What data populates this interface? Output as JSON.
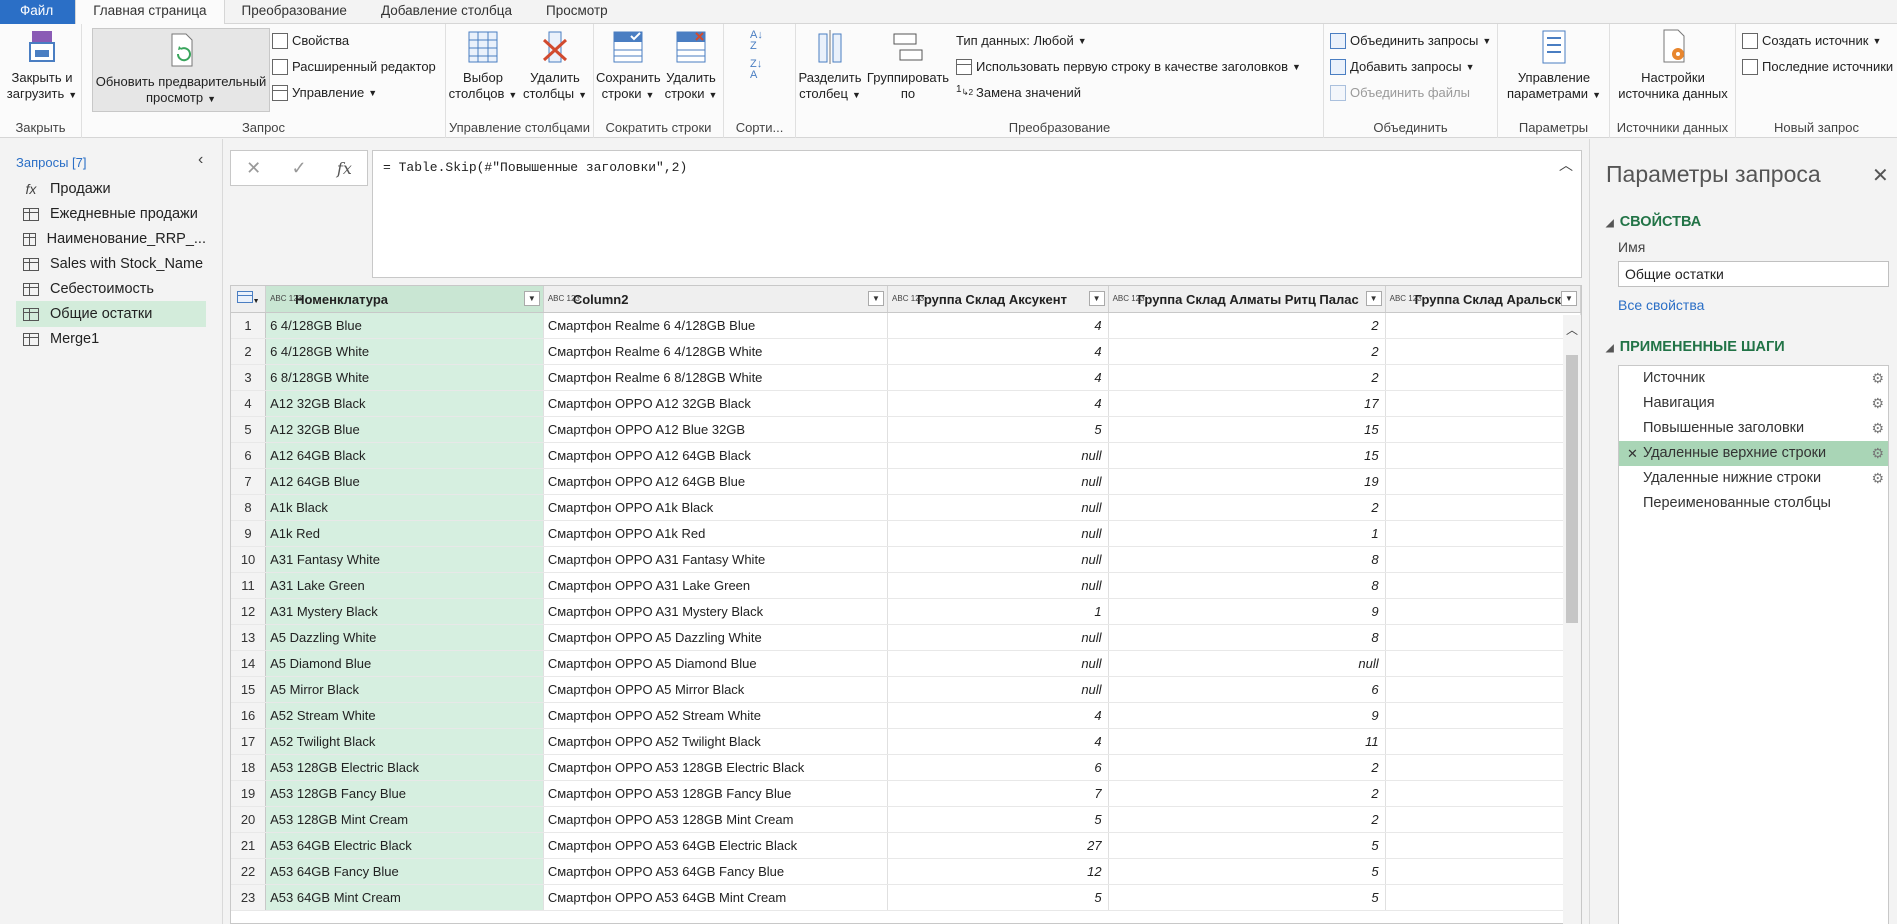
{
  "tabs": [
    {
      "label": "Файл"
    },
    {
      "label": "Главная страница"
    },
    {
      "label": "Преобразование"
    },
    {
      "label": "Добавление столбца"
    },
    {
      "label": "Просмотр"
    }
  ],
  "ribbon": {
    "close_load": "Закрыть и загрузить",
    "refresh": "Обновить предварительный просмотр",
    "properties": "Свойства",
    "advanced_editor": "Расширенный редактор",
    "manage": "Управление",
    "choose_columns": "Выбор столбцов",
    "remove_columns": "Удалить столбцы",
    "keep_rows": "Сохранить строки",
    "remove_rows": "Удалить строки",
    "split_column": "Разделить столбец",
    "group_by": "Группировать по",
    "data_type": "Тип данных: Любой",
    "first_row_headers": "Использовать первую строку в качестве заголовков",
    "replace_values": "Замена значений",
    "merge_queries": "Объединить запросы",
    "append_queries": "Добавить запросы",
    "combine_files": "Объединить файлы",
    "manage_params": "Управление параметрами",
    "datasource_settings": "Настройки источника данных",
    "new_source": "Создать источник",
    "recent_sources": "Последние источники",
    "groups": {
      "close": "Закрыть",
      "query": "Запрос",
      "manage_columns": "Управление столбцами",
      "reduce_rows": "Сократить строки",
      "sort": "Сорти...",
      "transform": "Преобразование",
      "combine": "Объединить",
      "parameters": "Параметры",
      "data_sources": "Источники данных",
      "new_query": "Новый запрос"
    }
  },
  "queries": {
    "header": "Запросы [7]",
    "items": [
      {
        "label": "Продажи",
        "icon": "fx-icon"
      },
      {
        "label": "Ежедневные продажи",
        "icon": "table-icon"
      },
      {
        "label": "Наименование_RRP_...",
        "icon": "table-icon"
      },
      {
        "label": "Sales with Stock_Name",
        "icon": "table-icon"
      },
      {
        "label": "Себестоимость",
        "icon": "table-icon"
      },
      {
        "label": "Общие остатки",
        "icon": "table-icon"
      },
      {
        "label": "Merge1",
        "icon": "table-icon"
      }
    ]
  },
  "formula": "= Table.Skip(#\"Повышенные заголовки\",2)",
  "grid": {
    "columns": [
      {
        "type": "ABC 123",
        "name": "Номенклатура"
      },
      {
        "type": "ABC 123",
        "name": "Column2"
      },
      {
        "type": "ABC 123",
        "name": "Группа Склад Аксукент"
      },
      {
        "type": "ABC 123",
        "name": "Группа Склад Алматы Ритц Палас"
      },
      {
        "type": "ABC 123",
        "name": "Группа Склад Аральск"
      }
    ],
    "rows": [
      [
        "1",
        "6 4/128GB Blue",
        "Смартфон Realme 6 4/128GB Blue",
        "4",
        "2",
        ""
      ],
      [
        "2",
        "6 4/128GB White",
        "Смартфон Realme 6 4/128GB White",
        "4",
        "2",
        ""
      ],
      [
        "3",
        "6 8/128GB White",
        "Смартфон Realme 6 8/128GB White",
        "4",
        "2",
        ""
      ],
      [
        "4",
        "A12 32GB Black",
        "Смартфон OPPO A12 32GB Black",
        "4",
        "17",
        "n"
      ],
      [
        "5",
        "A12 32GB Blue",
        "Смартфон OPPO A12 Blue 32GB",
        "5",
        "15",
        ""
      ],
      [
        "6",
        "A12 64GB Black",
        "Смартфон OPPO A12 64GB Black",
        "null",
        "15",
        "n"
      ],
      [
        "7",
        "A12 64GB Blue",
        "Смартфон OPPO A12 64GB Blue",
        "null",
        "19",
        "n"
      ],
      [
        "8",
        "A1k Black",
        "Смартфон OPPO A1k Black",
        "null",
        "2",
        "n"
      ],
      [
        "9",
        "A1k Red",
        "Смартфон OPPO A1k Red",
        "null",
        "1",
        "n"
      ],
      [
        "10",
        "A31 Fantasy White",
        "Смартфон OPPO A31 Fantasy White",
        "null",
        "8",
        "n"
      ],
      [
        "11",
        "A31 Lake Green",
        "Смартфон OPPO A31 Lake Green",
        "null",
        "8",
        "n"
      ],
      [
        "12",
        "A31 Mystery Black",
        "Смартфон OPPO A31 Mystery Black",
        "1",
        "9",
        ""
      ],
      [
        "13",
        "A5 Dazzling White",
        "Смартфон OPPO A5 Dazzling White",
        "null",
        "8",
        "n"
      ],
      [
        "14",
        "A5 Diamond Blue",
        "Смартфон OPPO A5 Diamond Blue",
        "null",
        "null",
        "n"
      ],
      [
        "15",
        "A5 Mirror Black",
        "Смартфон OPPO A5 Mirror Black",
        "null",
        "6",
        "n"
      ],
      [
        "16",
        "A52 Stream White",
        "Смартфон OPPO A52 Stream White",
        "4",
        "9",
        "n"
      ],
      [
        "17",
        "A52 Twilight Black",
        "Смартфон OPPO A52 Twilight Black",
        "4",
        "11",
        ""
      ],
      [
        "18",
        "A53 128GB Electric Black",
        "Смартфон OPPO A53 128GB Electric Black",
        "6",
        "2",
        ""
      ],
      [
        "19",
        "A53 128GB Fancy Blue",
        "Смартфон OPPO A53 128GB Fancy Blue",
        "7",
        "2",
        ""
      ],
      [
        "20",
        "A53 128GB Mint Cream",
        "Смартфон OPPO A53 128GB Mint Cream",
        "5",
        "2",
        ""
      ],
      [
        "21",
        "A53 64GB Electric Black",
        "Смартфон OPPO A53 64GB Electric Black",
        "27",
        "5",
        ""
      ],
      [
        "22",
        "A53 64GB Fancy Blue",
        "Смартфон OPPO A53 64GB Fancy Blue",
        "12",
        "5",
        ""
      ],
      [
        "23",
        "A53 64GB Mint Cream",
        "Смартфон OPPO A53 64GB Mint Cream",
        "5",
        "5",
        ""
      ]
    ]
  },
  "settings": {
    "title": "Параметры запроса",
    "properties_header": "СВОЙСТВА",
    "name_label": "Имя",
    "name_value": "Общие остатки",
    "all_properties": "Все свойства",
    "steps_header": "ПРИМЕНЕННЫЕ ШАГИ",
    "steps": [
      {
        "label": "Источник",
        "gear": true,
        "selected": false
      },
      {
        "label": "Навигация",
        "gear": true,
        "selected": false
      },
      {
        "label": "Повышенные заголовки",
        "gear": true,
        "selected": false
      },
      {
        "label": "Удаленные верхние строки",
        "gear": true,
        "selected": true
      },
      {
        "label": "Удаленные нижние строки",
        "gear": true,
        "selected": false
      },
      {
        "label": "Переименованные столбцы",
        "gear": false,
        "selected": false
      }
    ]
  },
  "colors": {
    "accent": "#2b6fc6",
    "selected_green": "#a9d5b6",
    "column_green": "#d6efe0",
    "excel_green": "#217346"
  }
}
